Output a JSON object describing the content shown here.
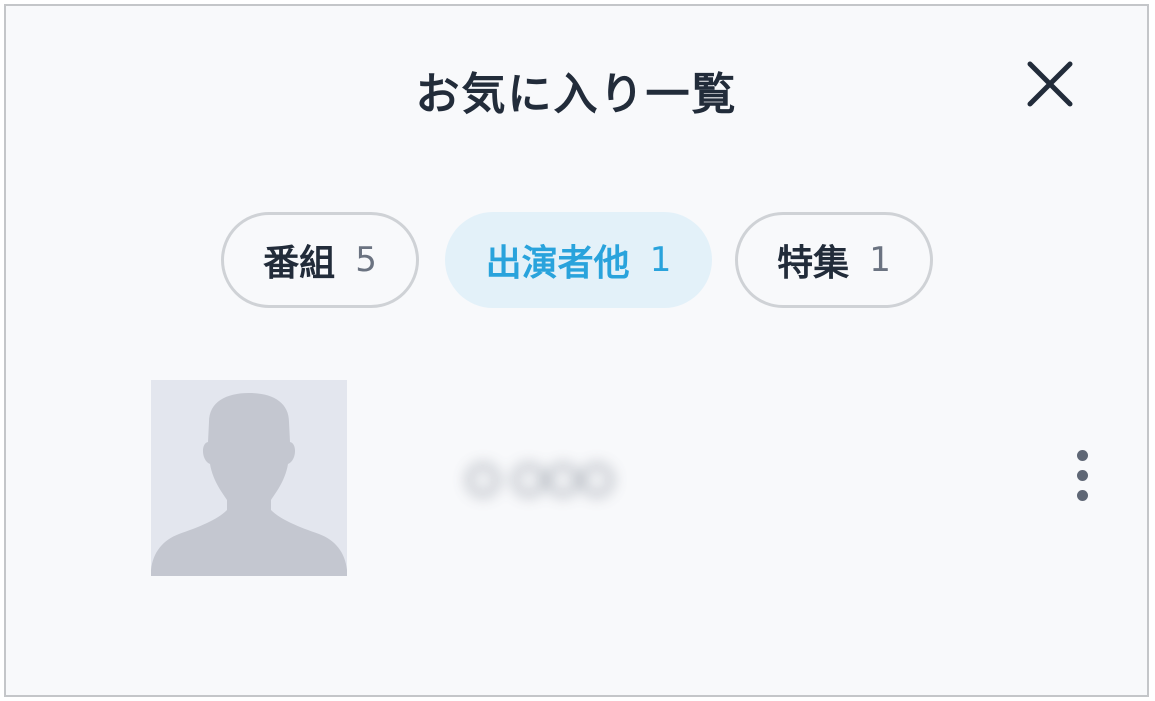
{
  "dialog": {
    "title": "お気に入り一覧",
    "close_icon": "close-icon"
  },
  "tabs": [
    {
      "label": "番組",
      "count": "5",
      "active": false
    },
    {
      "label": "出演者他",
      "count": "1",
      "active": true
    },
    {
      "label": "特集",
      "count": "1",
      "active": false
    }
  ],
  "list": {
    "items": [
      {
        "avatar_icon": "person-silhouette-icon",
        "name": "〇 〇〇〇",
        "name_blurred": true,
        "more_icon": "more-vertical-icon"
      }
    ]
  },
  "colors": {
    "background": "#f8f9fb",
    "title_text": "#222c3a",
    "active_tab_bg": "#e3f1f9",
    "active_tab_text": "#29a3dc",
    "inactive_tab_border": "#cfd2d6",
    "avatar_bg": "#e3e6ee",
    "avatar_silhouette": "#c4c7d0"
  }
}
